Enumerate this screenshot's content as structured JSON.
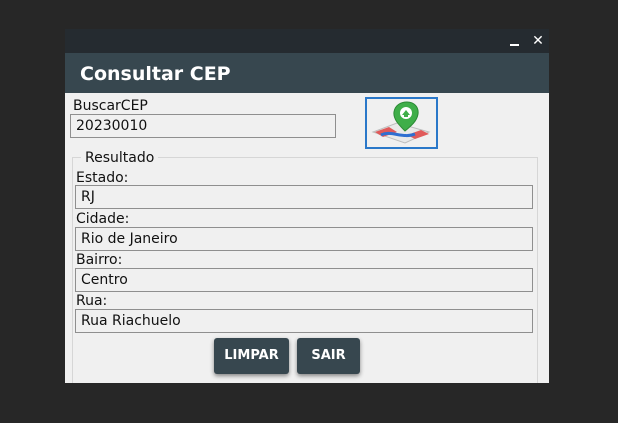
{
  "window": {
    "title": "Consultar CEP"
  },
  "controls": {
    "minimize": "–",
    "close": "✕"
  },
  "search": {
    "label": "BuscarCEP",
    "value": "20230010"
  },
  "logo": {
    "icon": "map-pin-cep-logo"
  },
  "result": {
    "legend": "Resultado",
    "estado_label": "Estado:",
    "estado_value": "RJ",
    "cidade_label": "Cidade:",
    "cidade_value": "Rio de Janeiro",
    "bairro_label": "Bairro:",
    "bairro_value": "Centro",
    "rua_label": "Rua:",
    "rua_value": "Rua Riachuelo"
  },
  "buttons": {
    "clear": "LIMPAR",
    "exit": "SAIR"
  },
  "colors": {
    "header": "#37474f",
    "topbar": "#252b30",
    "background": "#272727",
    "accent": "#2a78c9"
  }
}
